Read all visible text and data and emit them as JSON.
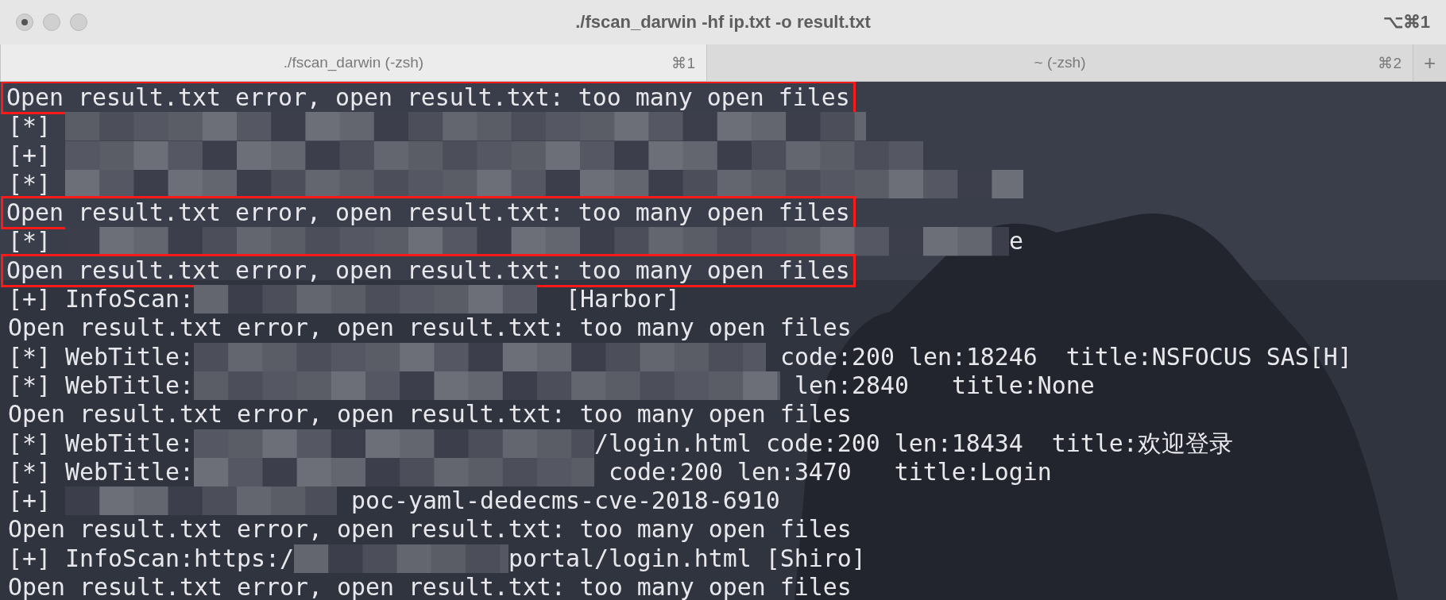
{
  "window": {
    "title": "./fscan_darwin -hf ip.txt -o result.txt",
    "shortcut": "⌥⌘1"
  },
  "tabs": [
    {
      "label": "./fscan_darwin (-zsh)",
      "shortcut": "⌘1",
      "selected": true
    },
    {
      "label": "~ (-zsh)",
      "shortcut": "⌘2",
      "selected": false
    }
  ],
  "new_tab": "+",
  "terminal": {
    "lines": [
      {
        "highlighted": true,
        "segments": [
          {
            "kind": "text",
            "text": "Open result.txt error, open result.txt: too many open files"
          }
        ]
      },
      {
        "highlighted": false,
        "segments": [
          {
            "kind": "text",
            "text": "[*] "
          },
          {
            "kind": "redacted"
          }
        ]
      },
      {
        "highlighted": false,
        "segments": [
          {
            "kind": "text",
            "text": "[+] "
          },
          {
            "kind": "redacted"
          }
        ]
      },
      {
        "highlighted": false,
        "segments": [
          {
            "kind": "text",
            "text": "[*] "
          },
          {
            "kind": "redacted"
          }
        ]
      },
      {
        "highlighted": true,
        "segments": [
          {
            "kind": "text",
            "text": "Open result.txt error, open result.txt: too many open files"
          }
        ]
      },
      {
        "highlighted": false,
        "segments": [
          {
            "kind": "text",
            "text": "[*] "
          },
          {
            "kind": "redacted"
          },
          {
            "kind": "text",
            "text": "e"
          }
        ]
      },
      {
        "highlighted": true,
        "segments": [
          {
            "kind": "text",
            "text": "Open result.txt error, open result.txt: too many open files"
          }
        ]
      },
      {
        "highlighted": false,
        "segments": [
          {
            "kind": "text",
            "text": "[+] InfoScan:"
          },
          {
            "kind": "redacted"
          },
          {
            "kind": "text",
            "text": "  [Harbor]"
          }
        ]
      },
      {
        "highlighted": false,
        "segments": [
          {
            "kind": "text",
            "text": "Open result.txt error, open result.txt: too many open files"
          }
        ]
      },
      {
        "highlighted": false,
        "segments": [
          {
            "kind": "text",
            "text": "[*] WebTitle:"
          },
          {
            "kind": "redacted"
          },
          {
            "kind": "text",
            "text": " code:200 len:18246  title:NSFOCUS SAS[H]"
          }
        ]
      },
      {
        "highlighted": false,
        "segments": [
          {
            "kind": "text",
            "text": "[*] WebTitle:"
          },
          {
            "kind": "redacted"
          },
          {
            "kind": "text",
            "text": " len:2840   title:None"
          }
        ]
      },
      {
        "highlighted": false,
        "segments": [
          {
            "kind": "text",
            "text": "Open result.txt error, open result.txt: too many open files"
          }
        ]
      },
      {
        "highlighted": false,
        "segments": [
          {
            "kind": "text",
            "text": "[*] WebTitle:"
          },
          {
            "kind": "redacted"
          },
          {
            "kind": "text",
            "text": "/login.html code:200 len:18434  title:欢迎登录"
          }
        ]
      },
      {
        "highlighted": false,
        "segments": [
          {
            "kind": "text",
            "text": "[*] WebTitle:"
          },
          {
            "kind": "redacted"
          },
          {
            "kind": "text",
            "text": " code:200 len:3470   title:Login"
          }
        ]
      },
      {
        "highlighted": false,
        "segments": [
          {
            "kind": "text",
            "text": "[+] "
          },
          {
            "kind": "redacted"
          },
          {
            "kind": "text",
            "text": " poc-yaml-dedecms-cve-2018-6910"
          }
        ]
      },
      {
        "highlighted": false,
        "segments": [
          {
            "kind": "text",
            "text": "Open result.txt error, open result.txt: too many open files"
          }
        ]
      },
      {
        "highlighted": false,
        "segments": [
          {
            "kind": "text",
            "text": "[+] InfoScan:https:/"
          },
          {
            "kind": "redacted"
          },
          {
            "kind": "text",
            "text": "portal/login.html [Shiro]"
          }
        ]
      },
      {
        "highlighted": false,
        "segments": [
          {
            "kind": "text",
            "text": "Open result.txt error, open result.txt: too many open files"
          }
        ]
      }
    ]
  }
}
